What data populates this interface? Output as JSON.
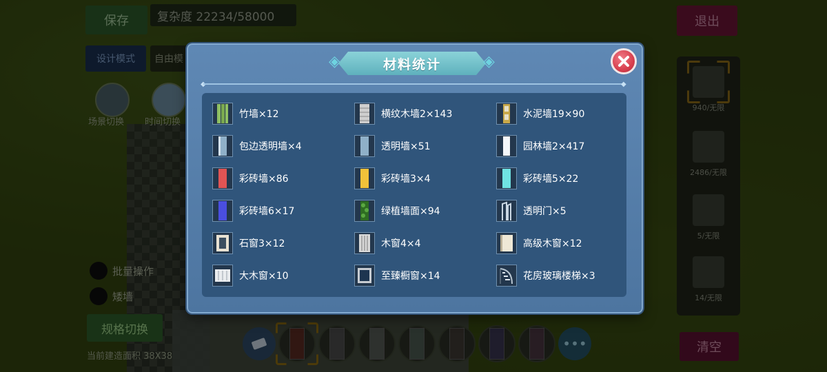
{
  "hud": {
    "save": "保存",
    "complexity": "复杂度 22234/58000",
    "exit": "退出",
    "design_mode": "设计模式",
    "free_mode": "自由模",
    "scene_switch": "场景切换",
    "time_switch": "时间切换",
    "batch_op": "批量操作",
    "short_wall": "矮墙",
    "spec_switch": "规格切换",
    "build_area": "当前建造面积 38X38",
    "clear": "清空",
    "right_counts": [
      "940/无限",
      "2486/无限",
      "5/无限",
      "14/无限"
    ]
  },
  "modal": {
    "title": "材料统计",
    "close_icon": "close-x-icon",
    "items": [
      {
        "name": "竹墙×12",
        "icon": "bamboo-wall-icon",
        "color": "#7fae5a"
      },
      {
        "name": "横纹木墙2×143",
        "icon": "striped-wood-wall-icon",
        "color": "#c8c8c8"
      },
      {
        "name": "水泥墙19×90",
        "icon": "cement-wall-icon",
        "color": "#c9a94a"
      },
      {
        "name": "包边透明墙×4",
        "icon": "edged-glass-wall-icon",
        "color": "#8fb0c8"
      },
      {
        "name": "透明墙×51",
        "icon": "glass-wall-icon",
        "color": "#8fb0c8"
      },
      {
        "name": "园林墙2×417",
        "icon": "garden-wall-icon",
        "color": "#f4f7fa"
      },
      {
        "name": "彩砖墙×86",
        "icon": "red-brick-wall-icon",
        "color": "#e05454"
      },
      {
        "name": "彩砖墙3×4",
        "icon": "yellow-brick-wall-icon",
        "color": "#f1c23a"
      },
      {
        "name": "彩砖墙5×22",
        "icon": "cyan-brick-wall-icon",
        "color": "#6fe3e3"
      },
      {
        "name": "彩砖墙6×17",
        "icon": "blue-brick-wall-icon",
        "color": "#4a4ee0"
      },
      {
        "name": "绿植墙面×94",
        "icon": "plant-wall-icon",
        "color": "#3e8a2c"
      },
      {
        "name": "透明门×5",
        "icon": "glass-door-icon",
        "color": "#9fb3c3"
      },
      {
        "name": "石窗3×12",
        "icon": "stone-window-icon",
        "color": "#e8e1d2"
      },
      {
        "name": "木窗4×4",
        "icon": "wood-window-icon",
        "color": "#d8d8d8"
      },
      {
        "name": "高级木窗×12",
        "icon": "premium-wood-window-icon",
        "color": "#efe8d6"
      },
      {
        "name": "大木窗×10",
        "icon": "large-wood-window-icon",
        "color": "#e9ecef"
      },
      {
        "name": "至臻橱窗×14",
        "icon": "showcase-window-icon",
        "color": "#1d3550"
      },
      {
        "name": "花房玻璃楼梯×3",
        "icon": "greenhouse-glass-stairs-icon",
        "color": "#b8c6d2"
      }
    ]
  }
}
